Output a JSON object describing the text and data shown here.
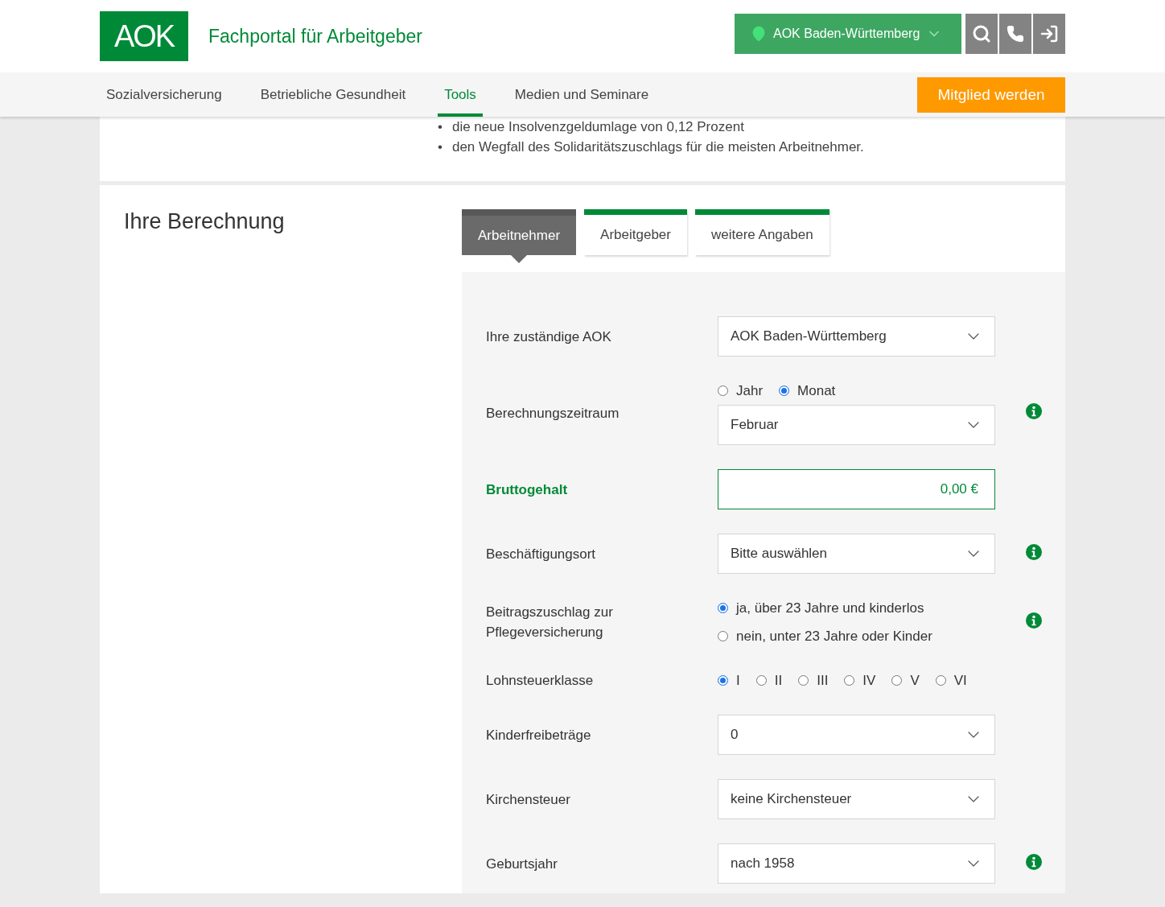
{
  "header": {
    "logo": "AOK",
    "title": "Fachportal für Arbeitgeber",
    "region": "AOK Baden-Württemberg"
  },
  "nav": {
    "items": [
      {
        "label": "Sozialversicherung",
        "selected": false
      },
      {
        "label": "Betriebliche Gesundheit",
        "selected": false
      },
      {
        "label": "Tools",
        "selected": true
      },
      {
        "label": "Medien und Seminare",
        "selected": false
      }
    ],
    "cta": "Mitglied werden"
  },
  "intro": {
    "bullets": [
      {
        "marker": "•",
        "text": "die neue Insolvenzgeldumlage von 0,12 Prozent"
      },
      {
        "marker": "•",
        "text": "den Wegfall des Solidaritätszuschlags für die meisten Arbeitnehmer."
      }
    ]
  },
  "calculation": {
    "title": "Ihre Berechnung",
    "tabs": [
      {
        "label": "Arbeitnehmer",
        "selected": true
      },
      {
        "label": "Arbeitgeber",
        "selected": false
      },
      {
        "label": "weitere Angaben",
        "selected": false
      }
    ],
    "rows": [
      {
        "kind": "select",
        "label": "Ihre zuständige AOK",
        "value": "AOK Baden-Württemberg",
        "info": false
      },
      {
        "kind": "select",
        "label": "Berechnungszeitraum",
        "options": [
          {
            "label": "Jahr",
            "selected": false
          },
          {
            "label": "Monat",
            "selected": true
          }
        ],
        "value": "Februar",
        "info": true
      },
      {
        "kind": "amount",
        "label": "Bruttogehalt",
        "value": "0,00 €",
        "info": false
      },
      {
        "kind": "select",
        "label": "Beschäftigungsort",
        "value": "Bitte auswählen",
        "info": true
      },
      {
        "kind": "stack",
        "label": "Beitragszuschlag zur Pflegeversicherung",
        "options": [
          {
            "label": "ja, über 23 Jahre und kinderlos",
            "selected": true
          },
          {
            "label": "nein, unter 23 Jahre oder Kinder",
            "selected": false
          }
        ],
        "info": true
      },
      {
        "kind": "inline",
        "label": "Lohnsteuerklasse",
        "options": [
          {
            "label": "I",
            "selected": true
          },
          {
            "label": "II",
            "selected": false
          },
          {
            "label": "III",
            "selected": false
          },
          {
            "label": "IV",
            "selected": false
          },
          {
            "label": "V",
            "selected": false
          },
          {
            "label": "VI",
            "selected": false
          }
        ],
        "info": false
      },
      {
        "kind": "select",
        "label": "Kinderfreibeträge",
        "value": "0",
        "info": false
      },
      {
        "kind": "select",
        "label": "Kirchensteuer",
        "value": "keine Kirchensteuer",
        "info": false
      },
      {
        "kind": "select",
        "label": "Geburtsjahr",
        "value": "nach 1958",
        "info": true
      }
    ]
  }
}
